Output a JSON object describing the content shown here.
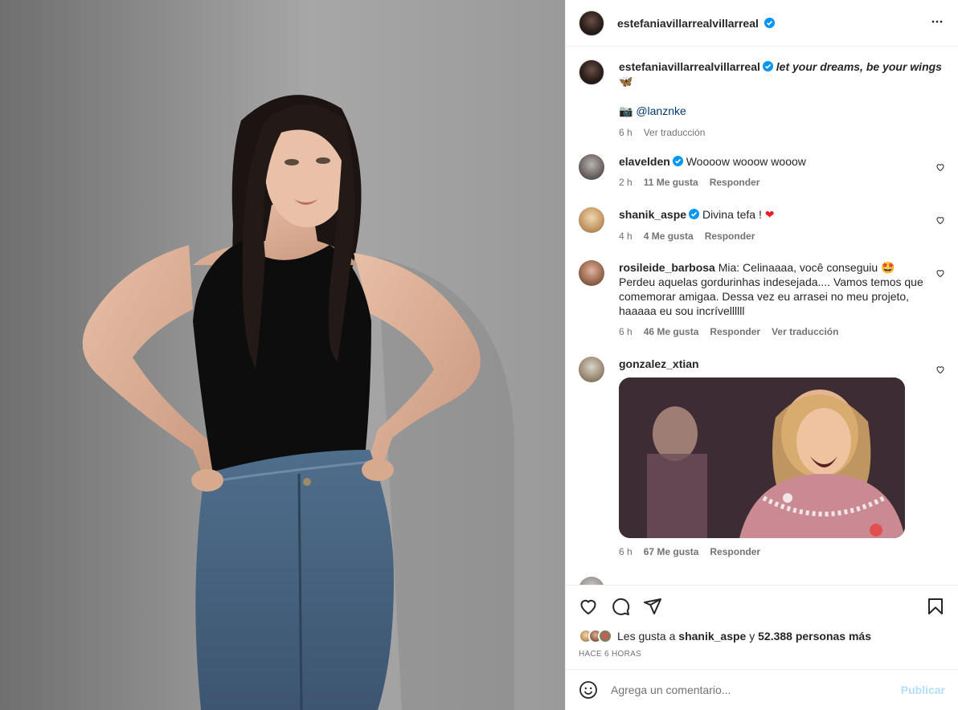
{
  "post": {
    "owner": "estefaniavillarrealvillarreal",
    "caption": "let your dreams, be your wings",
    "caption_emoji": "🦋",
    "credit_emoji": "📷",
    "credit_mention": "@lanznke",
    "caption_time": "6 h",
    "caption_translate": "Ver traducción"
  },
  "comments": [
    {
      "user": "elavelden",
      "text": "Woooow wooow wooow",
      "time": "2 h",
      "likes": "11 Me gusta",
      "reply": "Responder"
    },
    {
      "user": "shanik_aspe",
      "text": "Divina tefa !",
      "emoji": "❤",
      "time": "4 h",
      "likes": "4 Me gusta",
      "reply": "Responder"
    },
    {
      "user": "rosileide_barbosa",
      "text": "Mia: Celinaaaa, você conseguiu 🤩 Perdeu aquelas gordurinhas indesejada.... Vamos temos que comemorar amigaa. Dessa vez eu arrasei no meu projeto, haaaaa eu sou incrívellllll",
      "time": "6 h",
      "likes": "46 Me gusta",
      "reply": "Responder",
      "translate": "Ver traducción"
    },
    {
      "user": "gonzalez_xtian",
      "time": "6 h",
      "likes": "67 Me gusta",
      "reply": "Responder"
    }
  ],
  "likes": {
    "prefix": "Les gusta a",
    "user": "shanik_aspe",
    "conj": "y",
    "others": "52.388 personas más"
  },
  "time_ago": "HACE 6 HORAS",
  "comment_box": {
    "placeholder": "Agrega un comentario...",
    "publish": "Publicar"
  },
  "icons": {
    "more": "more-horizontal-icon",
    "like": "heart-icon",
    "comment": "comment-bubble-icon",
    "share": "paper-plane-icon",
    "save": "bookmark-icon",
    "emoji": "emoji-smile-icon",
    "verified": "verified-badge-icon"
  },
  "colors": {
    "verified": "#0095f6",
    "link": "#00376b",
    "publish_disabled": "#b2dffc",
    "heart_red": "#ed1c24"
  }
}
